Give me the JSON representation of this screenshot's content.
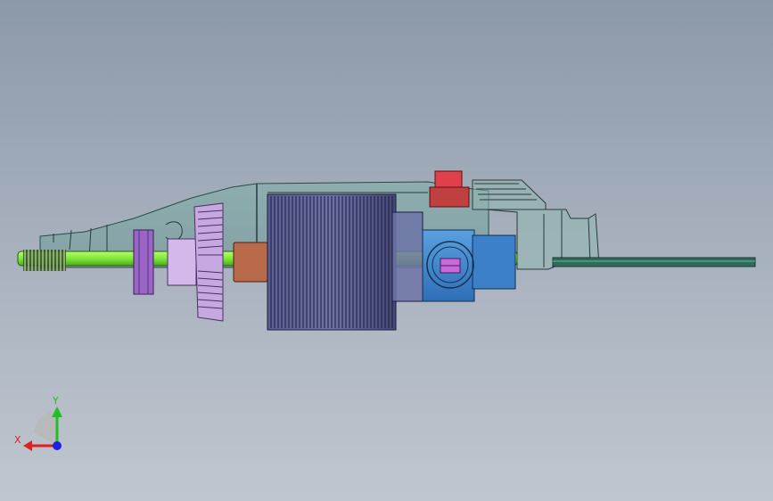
{
  "viewport": {
    "background_top": "#8c99a9",
    "background_bottom": "#c0c6cf"
  },
  "model": {
    "housing_color": "#5e8f8a",
    "shaft_color": "#7ee83a",
    "stator_color": "#4a4e7a",
    "gear_color": "#c8a8e0",
    "collar_color": "#9a66c6",
    "bushing_color": "#b86a4a",
    "switch_color": "#e0404a",
    "bearing_color": "#3b80c8",
    "lock_color": "#c86ad8",
    "cord_color": "#2f6a5a"
  },
  "triad": {
    "x_label": "X",
    "y_label": "Y",
    "x_color": "#e02020",
    "y_color": "#20c020",
    "z_color": "#2020e0"
  }
}
